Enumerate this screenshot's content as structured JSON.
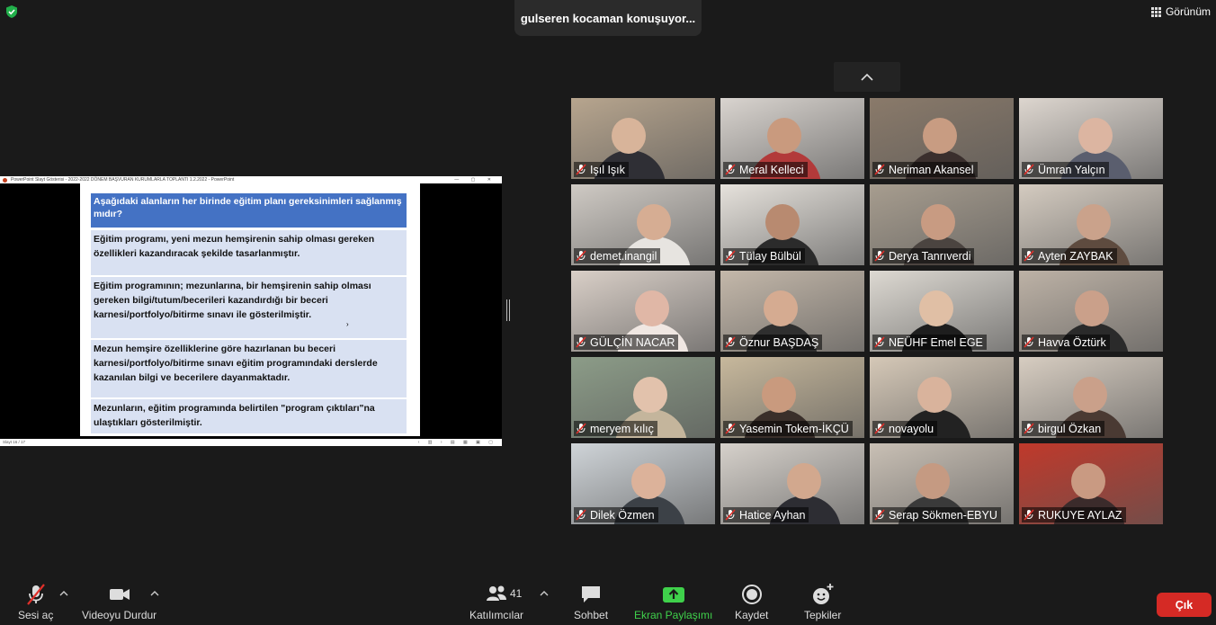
{
  "top": {
    "speaker_text": "gulseren kocaman konuşuyor...",
    "view_label": "Görünüm"
  },
  "share": {
    "window_title": "PowerPoint Slayt Gösterisi  -  2022-2022 DÖNEM BAŞVURAN KURUMLARLA TOPLANTI 1.2.2022 - PowerPoint",
    "status_left": "Slayt 16 / 17",
    "question": "Aşağıdaki alanların her birinde eğitim planı gereksinimleri sağlanmış mıdır?",
    "rows": [
      "Eğitim programı, yeni mezun hemşirenin sahip olması gereken özellikleri kazandıracak şekilde tasarlanmıştır.",
      "Eğitim programının; mezunlarına, bir  hemşirenin sahip olması gereken bilgi/tutum/becerileri  kazandırdığı bir beceri karnesi/portfolyo/bitirme sınavı ile gösterilmiştir.",
      "Mezun hemşire özelliklerine göre hazırlanan bu beceri karnesi/portfolyo/bitirme sınavı  eğitim programındaki derslerde kazanılan bilgi ve becerilere dayanmaktadır.",
      "Mezunların, eğitim programında belirtilen \"program çıktıları\"na ulaştıkları gösterilmiştir."
    ]
  },
  "participants": [
    {
      "name": "Işıl Işık",
      "wall": "#b7a58e",
      "skin": "#d8b49a",
      "shirt": "#2f2f35"
    },
    {
      "name": "Meral Kelleci",
      "wall": "#d9d4cf",
      "skin": "#c99a7e",
      "shirt": "#b23a3a"
    },
    {
      "name": "Neriman Akansel",
      "wall": "#8a7a6a",
      "skin": "#c89c82",
      "shirt": "#3a2f2d"
    },
    {
      "name": "Ümran Yalçın",
      "wall": "#ddd6cf",
      "skin": "#dcb5a1",
      "shirt": "#5a5e6e"
    },
    {
      "name": "demet.inangil",
      "wall": "#cfcac4",
      "skin": "#d6ad93",
      "shirt": "#e7e4e0"
    },
    {
      "name": "Tülay Bülbül",
      "wall": "#e6e2dc",
      "skin": "#b88a70",
      "shirt": "#2b2b2b"
    },
    {
      "name": "Derya Tanrıverdi",
      "wall": "#a79d8f",
      "skin": "#c89b82",
      "shirt": "#4b4440"
    },
    {
      "name": "Ayten ZAYBAK",
      "wall": "#d4cbc0",
      "skin": "#caa28b",
      "shirt": "#5e4b3f"
    },
    {
      "name": "GÜLÇİN NACAR",
      "wall": "#d9cfc7",
      "skin": "#e0b7a6",
      "shirt": "#f0e7e2"
    },
    {
      "name": "Öznur BAŞDAŞ",
      "wall": "#c4b8aa",
      "skin": "#d5ab91",
      "shirt": "#2f2f2f"
    },
    {
      "name": "NEÜHF Emel EGE",
      "wall": "#ddd9d2",
      "skin": "#e0bfa5",
      "shirt": "#1e1e1e"
    },
    {
      "name": "Havva Öztürk",
      "wall": "#bdb2a6",
      "skin": "#caa08a",
      "shirt": "#2a2a2a"
    },
    {
      "name": "meryem kılıç",
      "wall": "#8c9c88",
      "skin": "#e2c2ac",
      "shirt": "#c4b59c"
    },
    {
      "name": "Yasemin Tokem-İKÇÜ",
      "wall": "#c7b89c",
      "skin": "#c99a7e",
      "shirt": "#3a2f2a"
    },
    {
      "name": "novayolu",
      "wall": "#d5c8b7",
      "skin": "#d9b39c",
      "shirt": "#222"
    },
    {
      "name": "birgul Özkan",
      "wall": "#d7cdc1",
      "skin": "#caa08a",
      "shirt": "#4a3a33"
    },
    {
      "name": "Dilek Özmen",
      "wall": "#cfd4d8",
      "skin": "#dcb29a",
      "shirt": "#3c4147"
    },
    {
      "name": "Hatice Ayhan",
      "wall": "#d6d1cb",
      "skin": "#d2a88e",
      "shirt": "#2d2d33"
    },
    {
      "name": "Serap Sökmen-EBYU",
      "wall": "#c9c0b5",
      "skin": "#c59a82",
      "shirt": "#3a3a3a"
    },
    {
      "name": "RUKUYE AYLAZ",
      "wall": "#c0392b",
      "skin": "#c99a82",
      "shirt": "#3b2b2b"
    }
  ],
  "toolbar": {
    "mute_label": "Sesi aç",
    "video_label": "Videoyu Durdur",
    "participants_label": "Katılımcılar",
    "participants_count": "41",
    "chat_label": "Sohbet",
    "share_label": "Ekran Paylaşımı",
    "record_label": "Kaydet",
    "reactions_label": "Tepkiler",
    "leave_label": "Çık"
  },
  "colors": {
    "background": "#1a1a1a",
    "share_green": "#3fd14b",
    "leave_red": "#d52a25",
    "slide_header_blue": "#4472c4",
    "slide_row_blue": "#d9e1f2"
  }
}
